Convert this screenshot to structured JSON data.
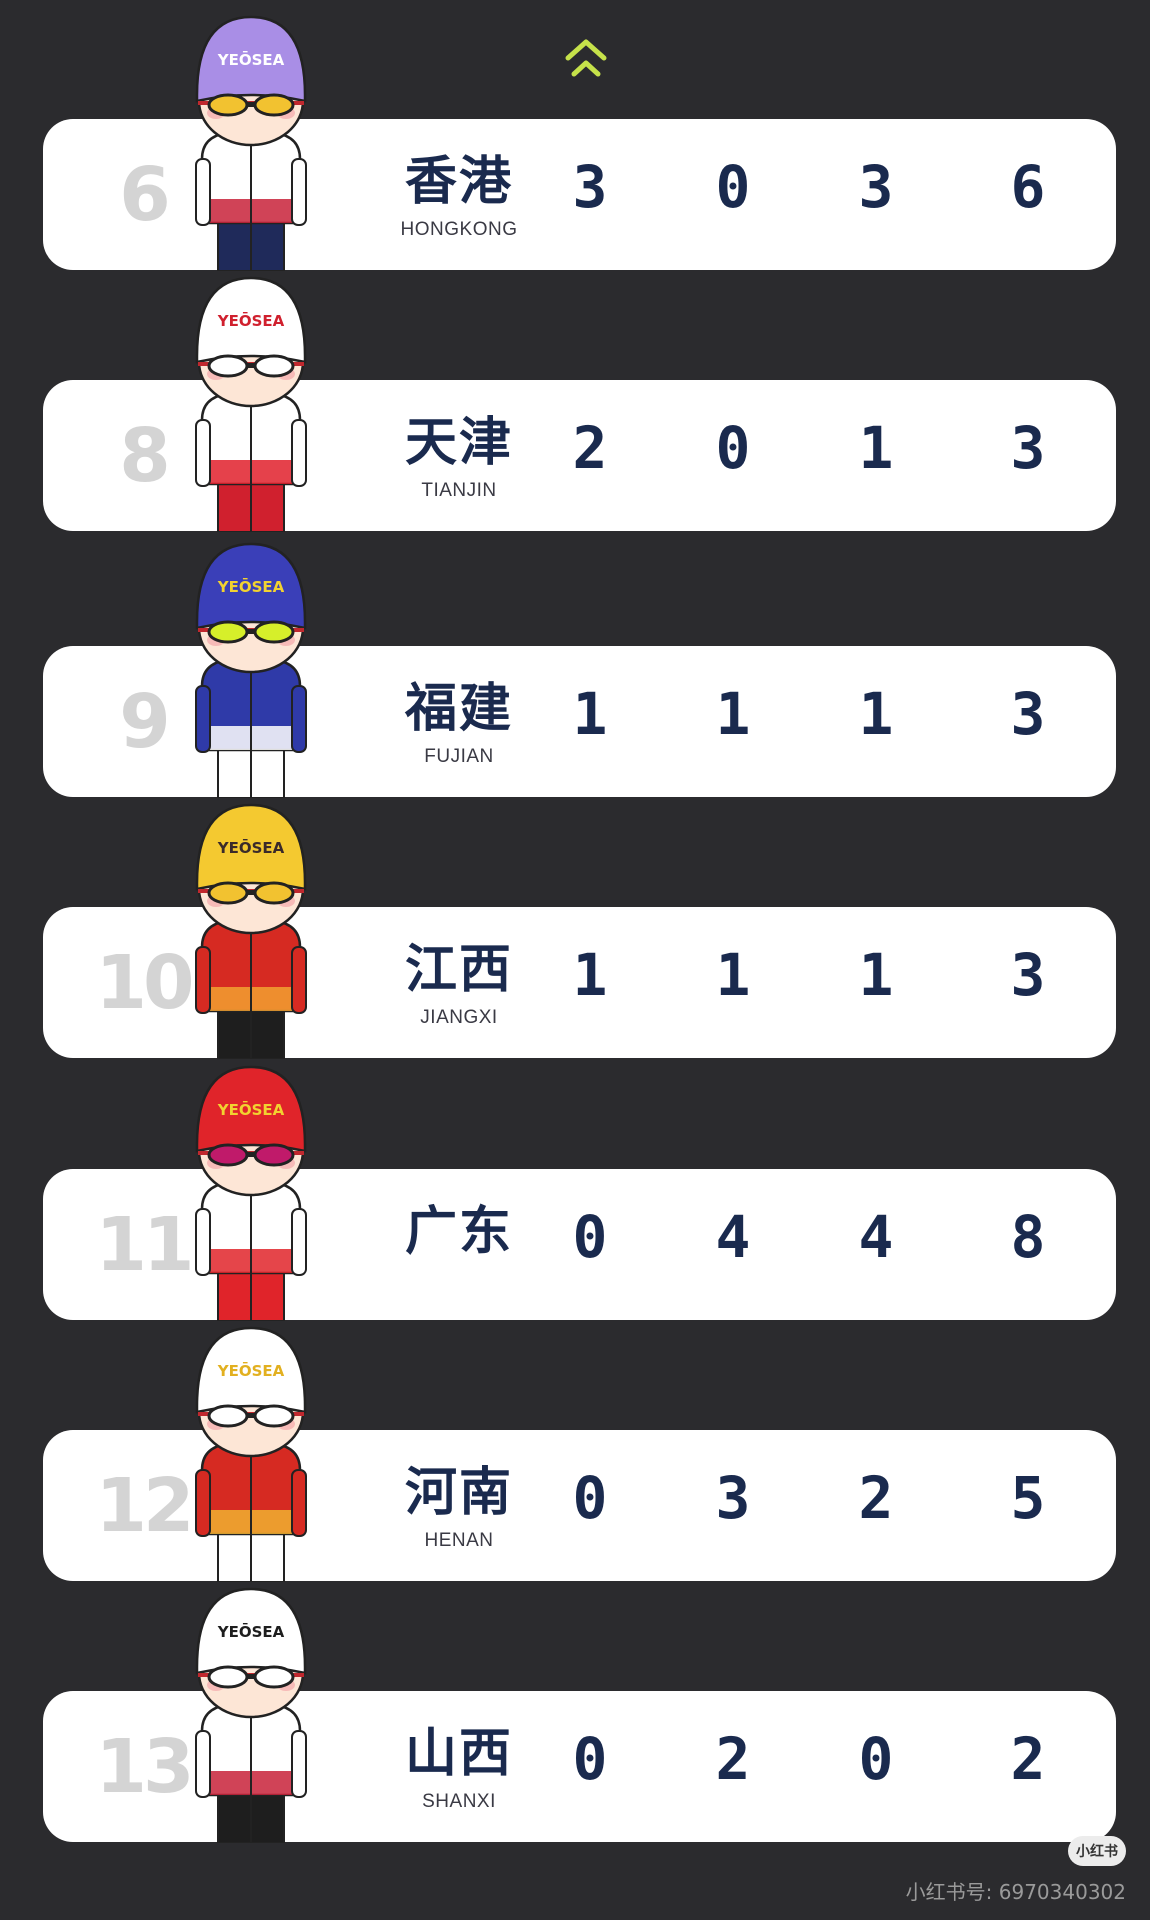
{
  "colors": {
    "background": "#2b2b2e",
    "card": "#ffffff",
    "rank_text": "#d4d4d4",
    "team_text": "#1a2a4e",
    "arrow": "#c6e24a"
  },
  "scroll_up_icon": "double-chevron-up-icon",
  "rows": [
    {
      "rank": "6",
      "team_cn": "香港",
      "team_en": "HONGKONG",
      "gold": "3",
      "silver": "0",
      "bronze": "3",
      "total": "6",
      "cap_text": "YEŌSEA",
      "cap_color": "#a98ee6",
      "cap_text_color": "#ffffff",
      "lens_color": "#f2c230",
      "jacket_color": "#ffffff",
      "jacket_trim": "#c8223a",
      "pants_color": "#1f2a5a"
    },
    {
      "rank": "8",
      "team_cn": "天津",
      "team_en": "TIANJIN",
      "gold": "2",
      "silver": "0",
      "bronze": "1",
      "total": "3",
      "cap_text": "YEŌSEA",
      "cap_color": "#ffffff",
      "cap_text_color": "#d0202e",
      "lens_color": "#ffffff",
      "jacket_color": "#ffffff",
      "jacket_trim": "#e0202c",
      "pants_color": "#d0202e"
    },
    {
      "rank": "9",
      "team_cn": "福建",
      "team_en": "FUJIAN",
      "gold": "1",
      "silver": "1",
      "bronze": "1",
      "total": "3",
      "cap_text": "YEŌSEA",
      "cap_color": "#3a3fb8",
      "cap_text_color": "#f2d230",
      "lens_color": "#d6ef2a",
      "jacket_color": "#2f3aa8",
      "jacket_trim": "#ffffff",
      "pants_color": "#ffffff"
    },
    {
      "rank": "10",
      "team_cn": "江西",
      "team_en": "JIANGXI",
      "gold": "1",
      "silver": "1",
      "bronze": "1",
      "total": "3",
      "cap_text": "YEŌSEA",
      "cap_color": "#f4c930",
      "cap_text_color": "#3a2a2a",
      "lens_color": "#f2c230",
      "jacket_color": "#d62a22",
      "jacket_trim": "#f2a030",
      "pants_color": "#1e1e1e"
    },
    {
      "rank": "11",
      "team_cn": "广东",
      "team_en": "",
      "gold": "0",
      "silver": "4",
      "bronze": "4",
      "total": "8",
      "cap_text": "YEŌSEA",
      "cap_color": "#e0242a",
      "cap_text_color": "#f2d230",
      "lens_color": "#c01a6a",
      "jacket_color": "#ffffff",
      "jacket_trim": "#e0242a",
      "pants_color": "#e0242a"
    },
    {
      "rank": "12",
      "team_cn": "河南",
      "team_en": "HENAN",
      "gold": "0",
      "silver": "3",
      "bronze": "2",
      "total": "5",
      "cap_text": "YEŌSEA",
      "cap_color": "#ffffff",
      "cap_text_color": "#e2b020",
      "lens_color": "#ffffff",
      "jacket_color": "#d62a22",
      "jacket_trim": "#f0b030",
      "pants_color": "#ffffff"
    },
    {
      "rank": "13",
      "team_cn": "山西",
      "team_en": "SHANXI",
      "gold": "0",
      "silver": "2",
      "bronze": "0",
      "total": "2",
      "cap_text": "YEŌSEA",
      "cap_color": "#ffffff",
      "cap_text_color": "#1e1e1e",
      "lens_color": "#ffffff",
      "jacket_color": "#ffffff",
      "jacket_trim": "#c8223a",
      "pants_color": "#1e1e1e"
    }
  ],
  "footer": {
    "logo_text": "小红书",
    "watermark": "小红书号: 6970340302"
  }
}
